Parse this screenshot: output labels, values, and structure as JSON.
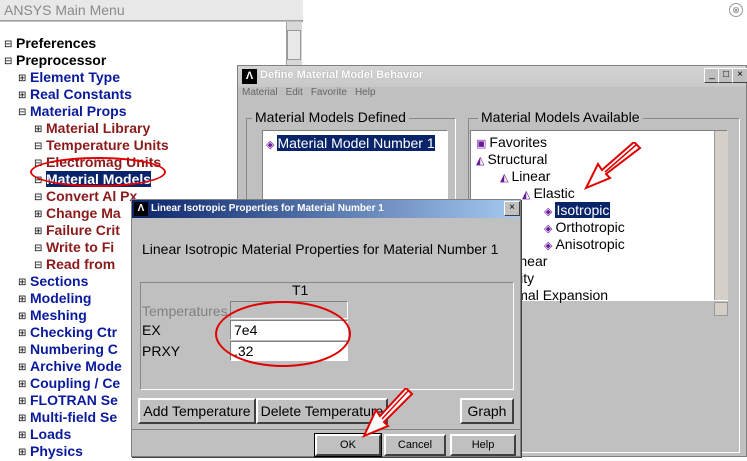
{
  "main_menu": {
    "title": "ANSYS Main Menu",
    "title_btn": "⊗",
    "items": [
      {
        "exp": "⊟",
        "label": "Preferences"
      },
      {
        "exp": "⊟",
        "label": "Preprocessor"
      },
      {
        "exp": "⊞",
        "label": "Element Type"
      },
      {
        "exp": "⊞",
        "label": "Real Constants"
      },
      {
        "exp": "⊟",
        "label": "Material Props"
      },
      {
        "exp": "⊞",
        "label": "Material Library"
      },
      {
        "exp": "⊟",
        "label": "Temperature Units"
      },
      {
        "exp": "⊟",
        "label": "Electromag Units"
      },
      {
        "exp": "⊟",
        "label": "Material Models"
      },
      {
        "exp": "⊟",
        "label": "Convert Al Px"
      },
      {
        "exp": "⊞",
        "label": "Change Ma"
      },
      {
        "exp": "⊞",
        "label": "Failure Crit"
      },
      {
        "exp": "⊟",
        "label": "Write to Fi"
      },
      {
        "exp": "⊟",
        "label": "Read from"
      },
      {
        "exp": "⊞",
        "label": "Sections"
      },
      {
        "exp": "⊞",
        "label": "Modeling"
      },
      {
        "exp": "⊞",
        "label": "Meshing"
      },
      {
        "exp": "⊞",
        "label": "Checking Ctr"
      },
      {
        "exp": "⊞",
        "label": "Numbering C"
      },
      {
        "exp": "⊞",
        "label": "Archive Mode"
      },
      {
        "exp": "⊞",
        "label": "Coupling / Ce"
      },
      {
        "exp": "⊞",
        "label": "FLOTRAN Se"
      },
      {
        "exp": "⊞",
        "label": "Multi-field Se"
      },
      {
        "exp": "⊞",
        "label": "Loads"
      },
      {
        "exp": "⊞",
        "label": "Physics"
      }
    ]
  },
  "dmm": {
    "title": "Define Material Model Behavior",
    "logo": "Λ",
    "menus": [
      "Material",
      "Edit",
      "Favorite",
      "Help"
    ],
    "win_buttons": [
      "_",
      "□",
      "×"
    ],
    "defined_label": "Material Models Defined",
    "defined_item": "Material Model Number 1",
    "available_label": "Material Models Available",
    "tree": [
      "Favorites",
      "Structural",
      "Linear",
      "Elastic",
      "Isotropic",
      "Orthotropic",
      "Anisotropic",
      "Nonlinear",
      "Density",
      "Thermal Expansion"
    ]
  },
  "lip": {
    "title": "Linear Isotropic Properties for Material Number 1",
    "logo": "Λ",
    "close": "×",
    "heading": "Linear Isotropic Material Properties for Material Number 1",
    "col_header": "T1",
    "temperatures_label": "Temperatures",
    "ex_label": "EX",
    "ex_value": "7e4",
    "prxy_label": "PRXY",
    "prxy_value": ".32",
    "add_temp": "Add Temperature",
    "delete_temp": "Delete Temperature",
    "graph": "Graph",
    "ok": "OK",
    "cancel": "Cancel",
    "help": "Help"
  },
  "colors": {
    "highlight": "#0a246a",
    "annotation": "#e00000"
  }
}
